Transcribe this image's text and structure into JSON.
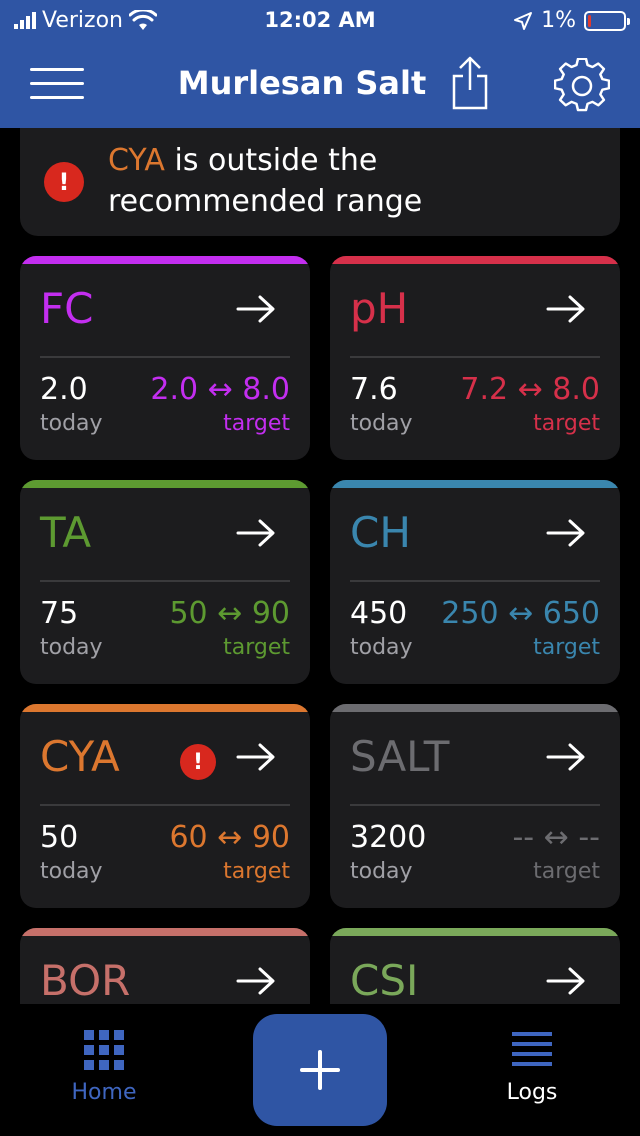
{
  "status_bar": {
    "carrier": "Verizon",
    "time": "12:02 AM",
    "battery": "1%",
    "battery_level": 0.05
  },
  "navbar": {
    "title": "Murlesan Salt"
  },
  "alert": {
    "highlight": "CYA",
    "message_line1": " is outside the",
    "message_line2": "recommended range",
    "icon": "!"
  },
  "cards": [
    {
      "name": "FC",
      "color": "#c32ef0",
      "today": "2.0",
      "today_label": "today",
      "range": "2.0 ↔ 8.0",
      "target_label": "target",
      "warning": false
    },
    {
      "name": "pH",
      "color": "#d6304a",
      "today": "7.6",
      "today_label": "today",
      "range": "7.2 ↔ 8.0",
      "target_label": "target",
      "warning": false
    },
    {
      "name": "TA",
      "color": "#5d9a31",
      "today": "75",
      "today_label": "today",
      "range": "50 ↔ 90",
      "target_label": "target",
      "warning": false
    },
    {
      "name": "CH",
      "color": "#3a86ae",
      "today": "450",
      "today_label": "today",
      "range": "250 ↔ 650",
      "target_label": "target",
      "warning": false
    },
    {
      "name": "CYA",
      "color": "#dc772f",
      "today": "50",
      "today_label": "today",
      "range": "60 ↔ 90",
      "target_label": "target",
      "warning": true
    },
    {
      "name": "SALT",
      "color": "#6c6c70",
      "today": "3200",
      "today_label": "today",
      "range": "-- ↔ --",
      "target_label": "target",
      "warning": false
    },
    {
      "name": "BOR",
      "color": "#c6706a",
      "today": "",
      "today_label": "",
      "range": "",
      "target_label": "",
      "warning": false
    },
    {
      "name": "CSI",
      "color": "#7aa85a",
      "today": "",
      "today_label": "",
      "range": "",
      "target_label": "",
      "warning": false
    }
  ],
  "tabbar": {
    "home_label": "Home",
    "logs_label": "Logs",
    "home_color": "#3f66c0",
    "fab_icon": "plus-icon"
  },
  "colors": {
    "header": "#2f55a4",
    "card_bg": "#1c1c1e",
    "alert_red": "#d8281e"
  }
}
